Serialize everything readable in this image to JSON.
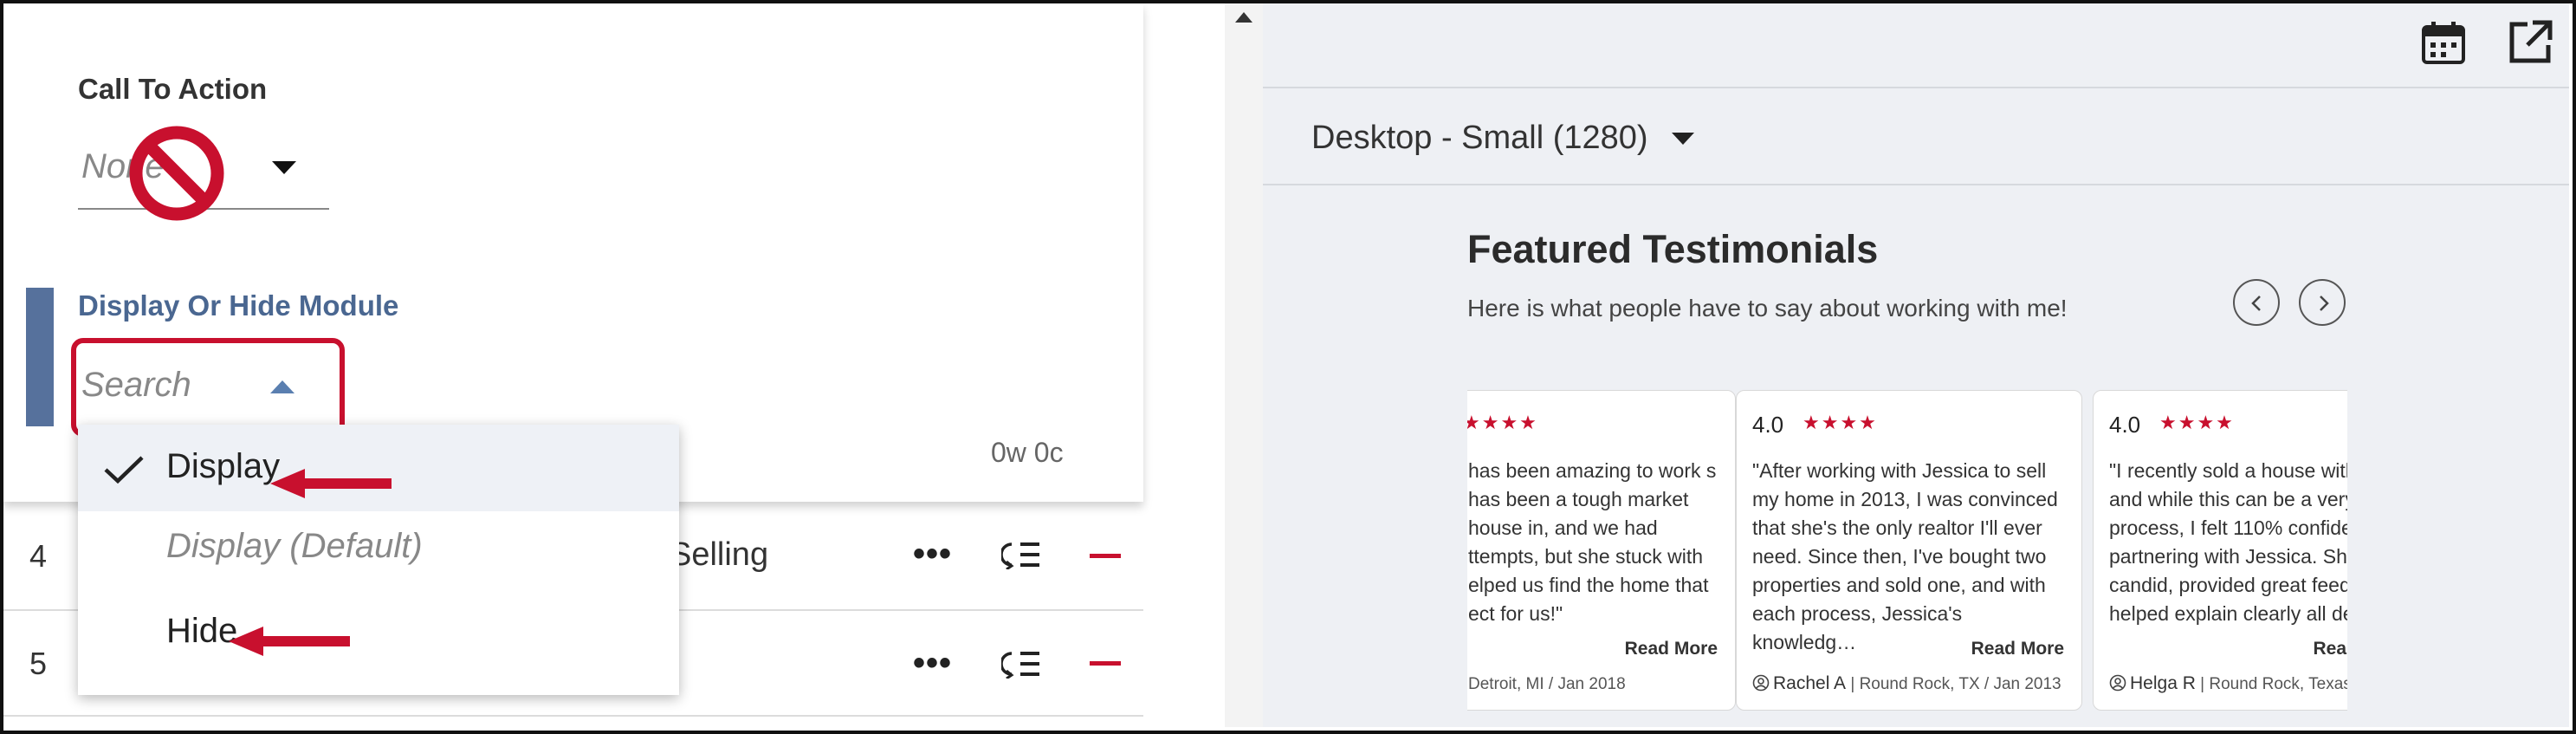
{
  "editor": {
    "cta_label": "Call To Action",
    "cta_value": "None",
    "dh_label": "Display Or Hide Module",
    "dh_placeholder": "Search",
    "counter": "0w 0c"
  },
  "dropdown": {
    "options": [
      {
        "label": "Display",
        "selected": true
      },
      {
        "label": "Display (Default)",
        "selected": false
      },
      {
        "label": "Hide",
        "selected": false
      }
    ]
  },
  "table": {
    "rows": [
      {
        "number": "4",
        "text": "l Selling",
        "actions": "•••"
      },
      {
        "number": "5",
        "text": "",
        "actions": "•••"
      }
    ]
  },
  "preview": {
    "viewport": "Desktop - Small (1280)",
    "title": "Featured Testimonials",
    "subtitle": "Here is what people have to say about working with me!",
    "cards": [
      {
        "rating": "",
        "stars": "★★★★",
        "quote": "has been amazing to work s has been a tough market house in, and we had ttempts, but she stuck with elped us find the home that ect for us!\"",
        "read_more": "Read More",
        "author": "",
        "meta": "Detroit, MI / Jan 2018"
      },
      {
        "rating": "4.0",
        "stars": "★★★★",
        "quote": "\"After working with Jessica to sell my home in 2013, I was convinced that she's the only realtor I'll ever need. Since then, I've bought two properties and sold one, and with each process, Jessica's knowledg…",
        "read_more": "Read More",
        "author": "Rachel A",
        "meta": "Round Rock, TX / Jan 2013"
      },
      {
        "rating": "4.0",
        "stars": "★★★★",
        "quote": "\"I recently sold a house with and while this can be a very process, I felt 110% confider partnering with Jessica. She candid, provided great feedl helped explain clearly all de",
        "read_more": "Rea",
        "author": "Helga R",
        "meta": "Round Rock, Texas /"
      }
    ]
  },
  "colors": {
    "accent_red": "#c8102e",
    "label_blue": "#4a6791",
    "bar_blue": "#56719c",
    "preview_bg": "#eef0f4"
  },
  "icons": [
    "no-symbol-icon",
    "checkmark-icon",
    "red-arrow-icon",
    "reorder-icon",
    "minus-icon",
    "calendar-icon",
    "external-link-icon",
    "chevron-left-icon",
    "chevron-right-icon",
    "user-icon",
    "caret-down-icon",
    "caret-up-icon"
  ]
}
